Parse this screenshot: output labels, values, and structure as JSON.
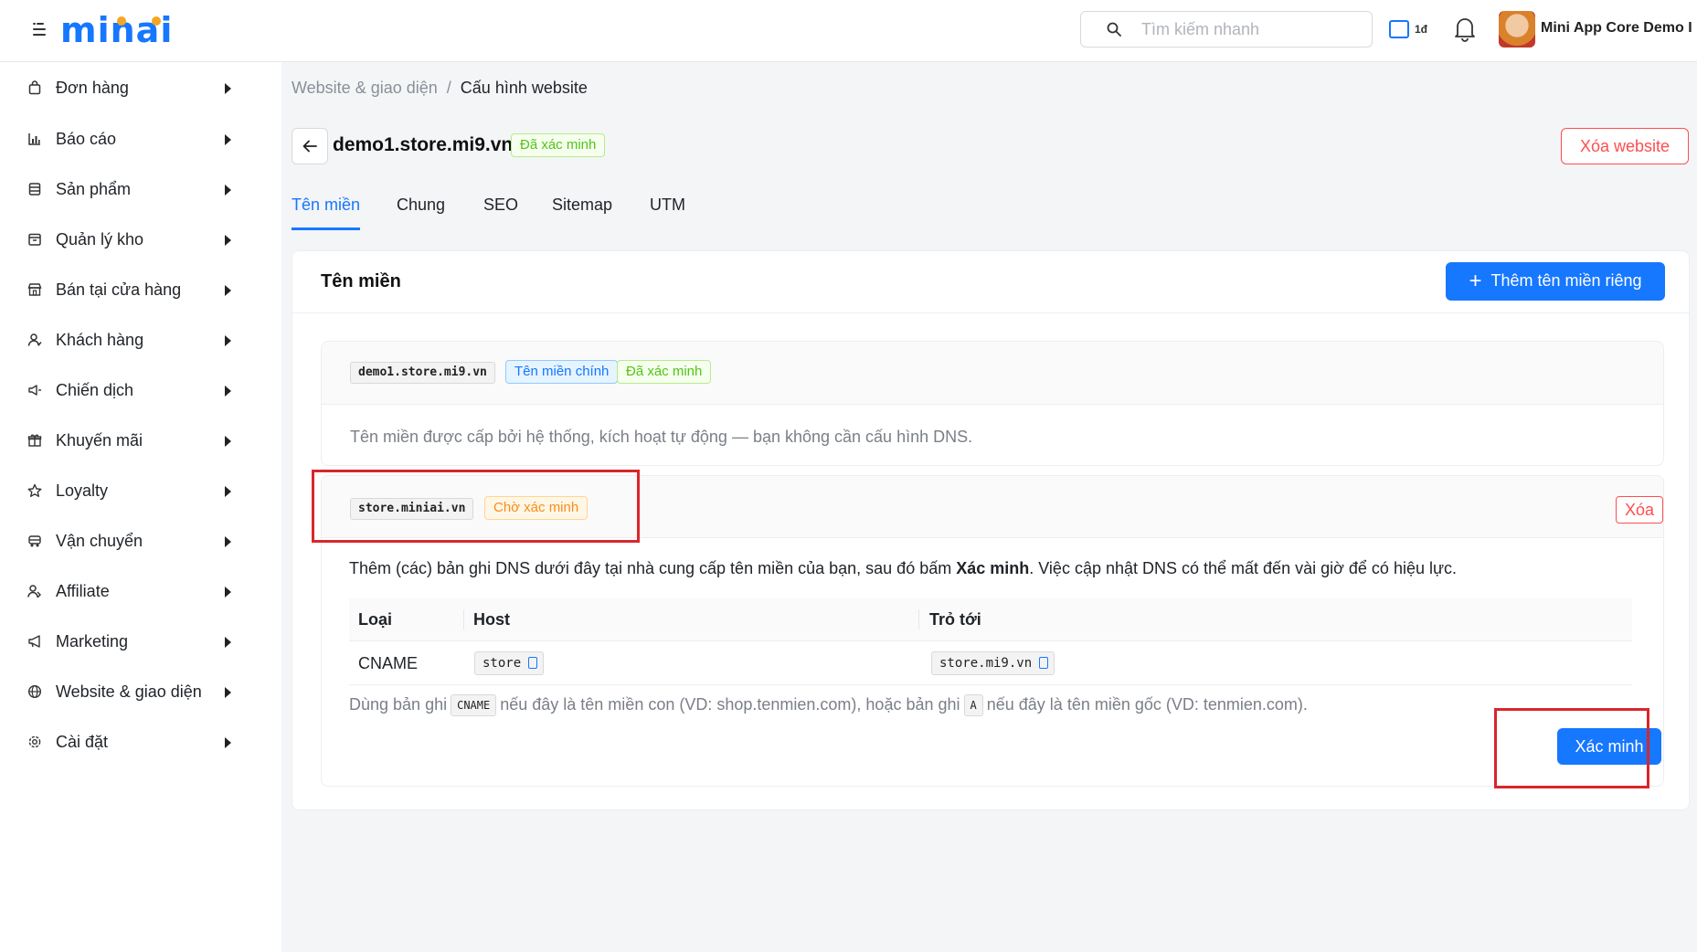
{
  "header": {
    "logo_text": "minai",
    "search_placeholder": "Tìm kiếm nhanh",
    "credit_label": "1đ",
    "user_name": "Mini App Core Demo I"
  },
  "sidebar": {
    "items": [
      {
        "label": "Đơn hàng",
        "icon": "bag-icon"
      },
      {
        "label": "Báo cáo",
        "icon": "chart-icon"
      },
      {
        "label": "Sản phẩm",
        "icon": "product-icon"
      },
      {
        "label": "Quản lý kho",
        "icon": "warehouse-icon"
      },
      {
        "label": "Bán tại cửa hàng",
        "icon": "store-icon"
      },
      {
        "label": "Khách hàng",
        "icon": "customer-icon"
      },
      {
        "label": "Chiến dịch",
        "icon": "campaign-icon"
      },
      {
        "label": "Khuyến mãi",
        "icon": "gift-icon"
      },
      {
        "label": "Loyalty",
        "icon": "star-icon"
      },
      {
        "label": "Vận chuyển",
        "icon": "truck-icon"
      },
      {
        "label": "Affiliate",
        "icon": "affiliate-icon"
      },
      {
        "label": "Marketing",
        "icon": "megaphone-icon"
      },
      {
        "label": "Website & giao diện",
        "icon": "globe-icon"
      },
      {
        "label": "Cài đặt",
        "icon": "settings-icon"
      }
    ]
  },
  "breadcrumb": {
    "parent": "Website & giao diện",
    "separator": "/",
    "current": "Cấu hình website"
  },
  "page": {
    "site_title": "demo1.store.mi9.vn",
    "status_tag": "Đã xác minh",
    "delete_website_label": "Xóa website"
  },
  "tabs": [
    {
      "label": "Tên miền",
      "active": true
    },
    {
      "label": "Chung",
      "active": false
    },
    {
      "label": "SEO",
      "active": false
    },
    {
      "label": "Sitemap",
      "active": false
    },
    {
      "label": "UTM",
      "active": false
    }
  ],
  "domains_card": {
    "title": "Tên miền",
    "add_button_label": "Thêm tên miền riêng",
    "primary_domain": {
      "name": "demo1.store.mi9.vn",
      "primary_tag": "Tên miền chính",
      "verified_tag": "Đã xác minh",
      "description": "Tên miền được cấp bởi hệ thống, kích hoạt tự động — bạn không cần cấu hình DNS."
    },
    "custom_domain": {
      "name": "store.miniai.vn",
      "pending_tag": "Chờ xác minh",
      "delete_label": "Xóa",
      "instruction_prefix": "Thêm (các) bản ghi DNS dưới đây tại nhà cung cấp tên miền của bạn, sau đó bấm ",
      "instruction_bold": "Xác minh",
      "instruction_suffix": ". Việc cập nhật DNS có thể mất đến vài giờ để có hiệu lực.",
      "table": {
        "headers": [
          "Loại",
          "Host",
          "Trỏ tới"
        ],
        "rows": [
          {
            "type": "CNAME",
            "host": "store",
            "target": "store.mi9.vn"
          }
        ]
      },
      "note": {
        "part1": "Dùng bản ghi",
        "code1": "CNAME",
        "part2": "nếu đây là tên miền con (VD: shop.tenmien.com), hoặc bản ghi",
        "code2": "A",
        "part3": "nếu đây là tên miền gốc (VD: tenmien.com)."
      },
      "verify_label": "Xác minh"
    }
  },
  "colors": {
    "primary": "#1677ff",
    "danger": "#ff4d4f",
    "success": "#52c41a",
    "warning": "#fa8c16",
    "highlight": "#d9262c"
  }
}
